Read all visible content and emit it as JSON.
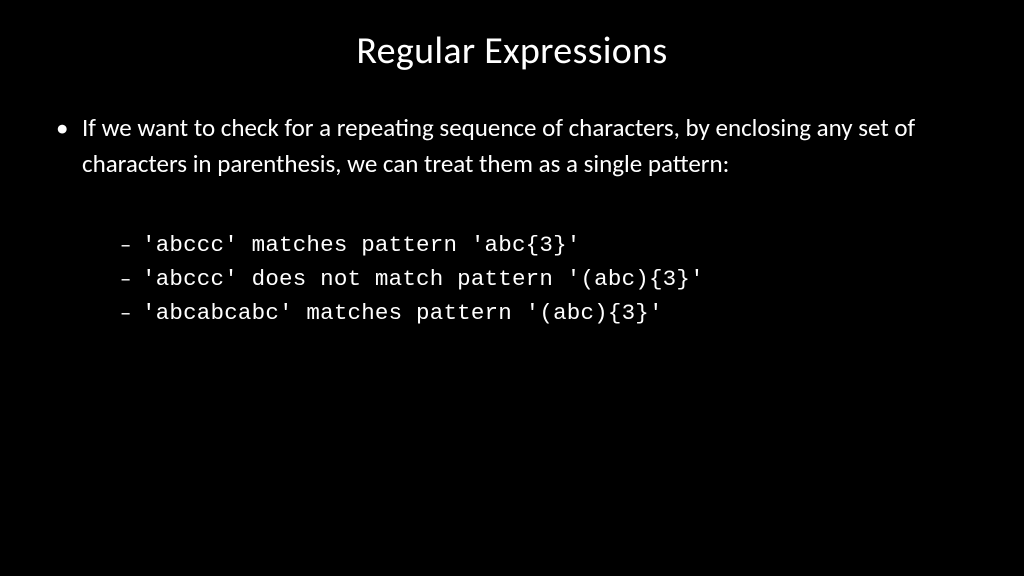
{
  "title": "Regular Expressions",
  "main_bullet": "If we want to check for a repeating sequence of characters, by enclosing any set of characters in parenthesis,  we can treat them as a single pattern:",
  "sub_items": [
    "'abccc' matches pattern 'abc{3}'",
    "'abccc' does not match pattern '(abc){3}'",
    "'abcabcabc' matches pattern '(abc){3}'"
  ]
}
